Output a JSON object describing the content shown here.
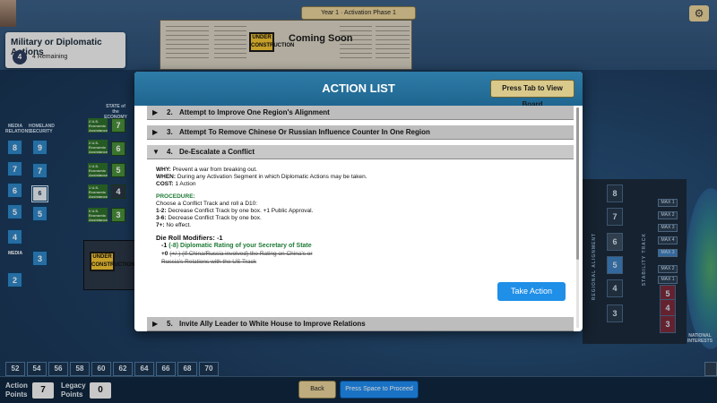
{
  "topbar": {
    "phase": "Year 1  ·  Activation Phase 1",
    "settings_icon": "gear-icon"
  },
  "board": {
    "coming_soon": "Coming Soon",
    "under_construction": "UNDER CONSTRUCTION"
  },
  "military_panel": {
    "title": "Military or Diplomatic Actions",
    "count": "4",
    "remaining": "4 Remaining"
  },
  "left_tracks": {
    "media_label": "MEDIA RELATIONS",
    "homeland_label": "HOMELAND SECURITY",
    "economy_label": "STATE of the ECONOMY",
    "media_values": [
      "8",
      "7",
      "6",
      "5",
      "4",
      "2"
    ],
    "homeland_values": [
      "9",
      "7",
      "6",
      "5",
      "3"
    ],
    "economy_values": [
      "7",
      "6",
      "5",
      "4",
      "3"
    ],
    "economy_labels": [
      "2 U.S. Economic Assistance",
      "2 U.S. Economic Assistance",
      "1 U.S. Economic Assistance",
      "1 U.S. Economic Assistance",
      "0 U.S. Economic Assistance"
    ]
  },
  "right_panel": {
    "alignment_values": [
      "8",
      "7",
      "6",
      "5",
      "4",
      "3"
    ],
    "regional_label": "REGIONAL ALIGNMENT",
    "stability_label": "STABILITY TRACK",
    "max_slots": [
      "MAX 1",
      "MAX 2",
      "MAX 3",
      "MAX 4",
      "MAX 3",
      "MAX 2",
      "MAX 1"
    ],
    "stability_values": [
      "5",
      "4",
      "3"
    ],
    "national_label": "NATIONAL INTERESTS"
  },
  "modal": {
    "title": "ACTION LIST",
    "view_board_button": "Press Tab to View Board",
    "actions": [
      {
        "num": "2.",
        "label": "Attempt to Improve One Region's Alignment"
      },
      {
        "num": "3.",
        "label": "Attempt To Remove Chinese Or Russian Influence Counter In One Region"
      },
      {
        "num": "4.",
        "label": "De-Escalate a Conflict"
      },
      {
        "num": "5.",
        "label": "Invite Ally Leader to White House to Improve Relations"
      }
    ],
    "details": {
      "why_label": "WHY:",
      "why": "Prevent a war from breaking out.",
      "when_label": "WHEN:",
      "when": "During any Activation Segment in which Diplomatic Actions may be taken.",
      "cost_label": "COST:",
      "cost": "1 Action",
      "procedure_label": "PROCEDURE:",
      "procedure_intro": "Choose a Conflict Track and roll a D10:",
      "r1_label": "1-2:",
      "r1": "Decrease Conflict Track by one box. +1 Public Approval.",
      "r2_label": "3-6:",
      "r2": "Decrease Conflict Track by one box.",
      "r3_label": "7+:",
      "r3": "No effect.",
      "modifiers_label": "Die Roll Modifiers:",
      "modifiers_total": "-1",
      "mod1_value": "-1",
      "mod1_text": "(-8) Diplomatic Rating of your Secretary of State",
      "mod2_value": "+0",
      "mod2_text": "(+/-) (If China/Russia involved) the Rating on China's or Russia's Relations with the US Track"
    },
    "take_action_button": "Take Action"
  },
  "bottom": {
    "track_numbers": [
      "52",
      "54",
      "56",
      "58",
      "60",
      "62",
      "64",
      "66",
      "68",
      "70"
    ],
    "action_points_label": "Action Points",
    "action_points": "7",
    "legacy_points_label": "Legacy Points",
    "legacy_points": "0",
    "back_button": "Back",
    "proceed_button": "Press Space to Proceed"
  }
}
